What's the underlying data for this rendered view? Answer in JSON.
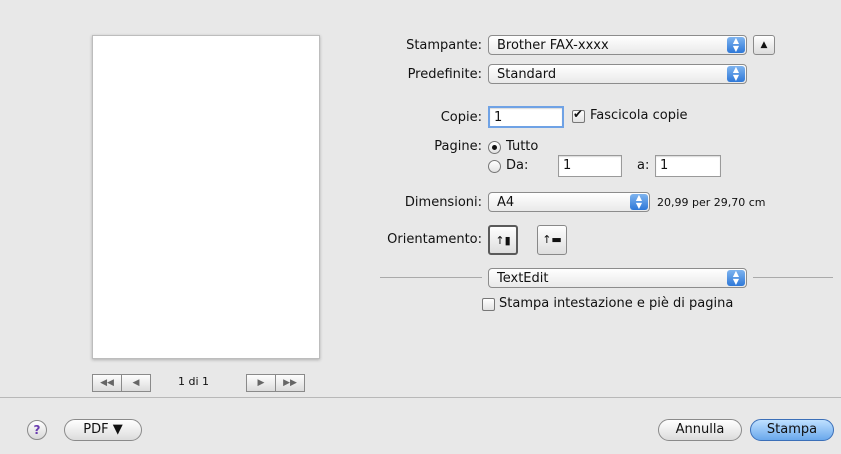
{
  "preview": {
    "page_indicator": "1 di 1",
    "nav_first": "◀◀",
    "nav_prev": "◀",
    "nav_next": "▶",
    "nav_last": "▶▶"
  },
  "form": {
    "printer_label": "Stampante:",
    "printer_value": "Brother FAX-xxxx",
    "presets_label": "Predefinite:",
    "presets_value": "Standard",
    "copies_label": "Copie:",
    "copies_value": "1",
    "collate_label": "Fascicola copie",
    "pages_label": "Pagine:",
    "all_label": "Tutto",
    "from_label": "Da:",
    "from_value": "1",
    "to_label": "a:",
    "to_value": "1",
    "size_label": "Dimensioni:",
    "size_value": "A4",
    "size_dims": "20,99 per 29,70 cm",
    "orientation_label": "Orientamento:",
    "app_section_value": "TextEdit",
    "header_footer_label": "Stampa intestazione e piè di pagina"
  },
  "footer": {
    "help_label": "?",
    "pdf_label": "PDF ▼",
    "cancel_label": "Annulla",
    "print_label": "Stampa"
  },
  "colors": {
    "accent": "#2f78d8",
    "print_button": "#7fb4ef"
  }
}
